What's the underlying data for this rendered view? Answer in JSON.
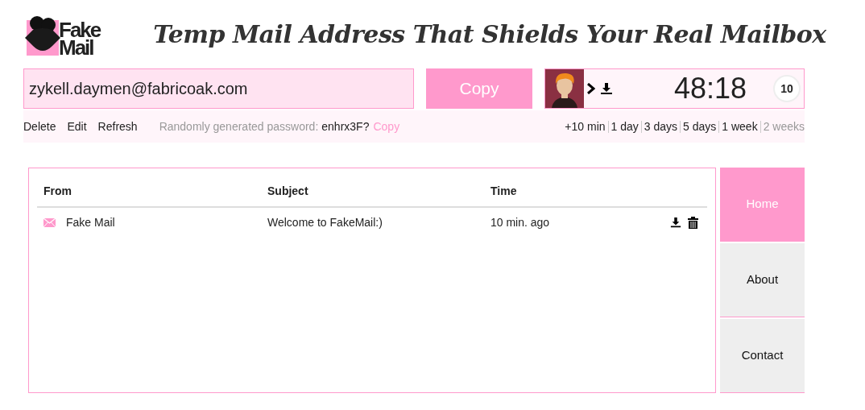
{
  "logo": {
    "line1": "Fake",
    "line2": "Mail"
  },
  "headline": "Temp Mail Address That Shields Your Real Mailbox",
  "email": {
    "value": "zykell.daymen@fabricoak.com"
  },
  "copy_button": "Copy",
  "timer": {
    "time": "48:18",
    "countdown": "10"
  },
  "actions": [
    "Delete",
    "Edit",
    "Refresh"
  ],
  "password": {
    "label": "Randomly generated password:",
    "value": "enhrx3F?",
    "copy": "Copy"
  },
  "extend_options": [
    {
      "label": "+10 min",
      "disabled": false
    },
    {
      "label": "1 day",
      "disabled": false
    },
    {
      "label": "3 days",
      "disabled": false
    },
    {
      "label": "5 days",
      "disabled": false
    },
    {
      "label": "1 week",
      "disabled": false
    },
    {
      "label": "2 weeks",
      "disabled": true
    }
  ],
  "table": {
    "columns": [
      "From",
      "Subject",
      "Time"
    ],
    "rows": [
      {
        "from": "Fake Mail",
        "subject": "Welcome to FakeMail:)",
        "time": "10 min. ago"
      }
    ]
  },
  "nav": [
    {
      "label": "Home",
      "selected": true
    },
    {
      "label": "About",
      "selected": false
    },
    {
      "label": "Contact",
      "selected": false
    }
  ]
}
